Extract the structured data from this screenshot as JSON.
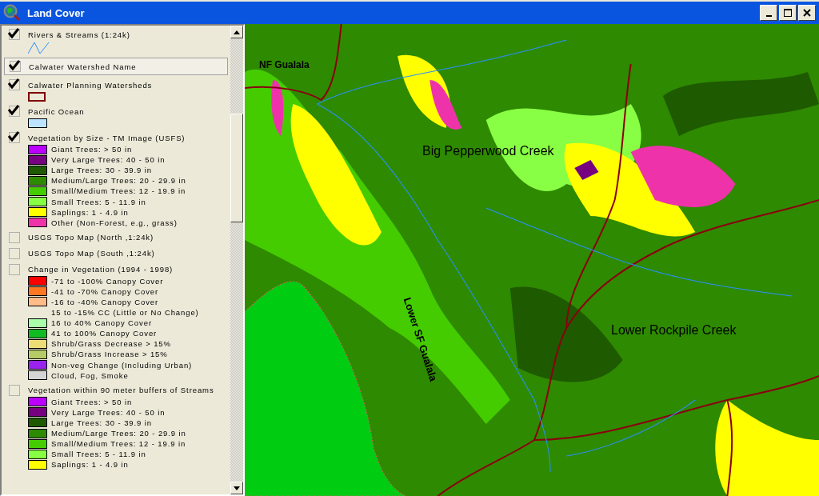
{
  "window": {
    "title": "Land Cover"
  },
  "layers": [
    {
      "name": "Rivers & Streams (1:24k)",
      "checked": true,
      "selected": false,
      "kind": "line"
    },
    {
      "name": "Calwater Watershed Name",
      "checked": true,
      "selected": true,
      "kind": "none"
    },
    {
      "name": "Calwater Planning Watersheds",
      "checked": true,
      "selected": false,
      "kind": "outline"
    },
    {
      "name": "Pacific Ocean",
      "checked": true,
      "selected": false,
      "kind": "fill"
    },
    {
      "name": "Vegetation by Size - TM Image (USFS)",
      "checked": true,
      "selected": false,
      "kind": "classes",
      "classes": [
        {
          "label": "Giant Trees: > 50 in",
          "color": "#bb00ff"
        },
        {
          "label": "Very Large Trees: 40 - 50 in",
          "color": "#760080"
        },
        {
          "label": "Large Trees: 30 - 39.9 in",
          "color": "#1e5a00"
        },
        {
          "label": "Medium/Large Trees: 20 - 29.9 in",
          "color": "#2e8a00"
        },
        {
          "label": "Small/Medium Trees: 12 - 19.9 in",
          "color": "#44cc00"
        },
        {
          "label": "Small Trees: 5 - 11.9 in",
          "color": "#88ff44"
        },
        {
          "label": "Saplings: 1 - 4.9 in",
          "color": "#ffff00"
        },
        {
          "label": "Other (Non-Forest, e.g., grass)",
          "color": "#ee33aa"
        }
      ]
    },
    {
      "name": "USGS Topo Map (North ,1:24k)",
      "checked": false,
      "selected": false,
      "kind": "none"
    },
    {
      "name": "USGS Topo Map (South ,1:24k)",
      "checked": false,
      "selected": false,
      "kind": "none"
    },
    {
      "name": "Change in Vegetation (1994 - 1998)",
      "checked": false,
      "selected": false,
      "kind": "classes",
      "classes": [
        {
          "label": "-71 to -100% Canopy Cover",
          "color": "#ff0000"
        },
        {
          "label": "-41 to -70% Canopy Cover",
          "color": "#ff7722"
        },
        {
          "label": "-16 to -40% Canopy Cover",
          "color": "#ffbb88"
        },
        {
          "label": "15 to -15% CC (Little or No Change)"
        },
        {
          "label": "16 to 40% Canopy Cover",
          "color": "#aaffaa"
        },
        {
          "label": "41 to 100% Canopy Cover",
          "color": "#11bb22"
        },
        {
          "label": "Shrub/Grass Decrease > 15%",
          "color": "#eedd77"
        },
        {
          "label": "Shrub/Grass Increase > 15%",
          "color": "#b5cc66"
        },
        {
          "label": "Non-veg Change (Including Urban)",
          "color": "#9922ee"
        },
        {
          "label": "Cloud, Fog, Smoke",
          "color": "#d4d4d4"
        }
      ]
    },
    {
      "name": "Vegetation within 90 meter buffers of Streams",
      "checked": false,
      "selected": false,
      "kind": "classes",
      "classes": [
        {
          "label": "Giant Trees: > 50 in",
          "color": "#bb00ff"
        },
        {
          "label": "Very Large Trees: 40 - 50 in",
          "color": "#760080"
        },
        {
          "label": "Large Trees: 30 - 39.9 in",
          "color": "#1e5a00"
        },
        {
          "label": "Medium/Large Trees: 20 - 29.9 in",
          "color": "#2e8a00"
        },
        {
          "label": "Small/Medium Trees: 12 - 19.9 in",
          "color": "#44cc00"
        },
        {
          "label": "Small Trees: 5 - 11.9 in",
          "color": "#88ff44"
        },
        {
          "label": "Saplings: 1 - 4.9 in",
          "color": "#ffff00"
        }
      ]
    }
  ],
  "map": {
    "labels": [
      {
        "text": "NF Gualala",
        "kind": "bold"
      },
      {
        "text": "Big Pepperwood Creek",
        "kind": "plain"
      },
      {
        "text": "Lower SF Gualala",
        "kind": "rotated"
      },
      {
        "text": "Lower Rockpile Creek",
        "kind": "plain"
      }
    ]
  }
}
